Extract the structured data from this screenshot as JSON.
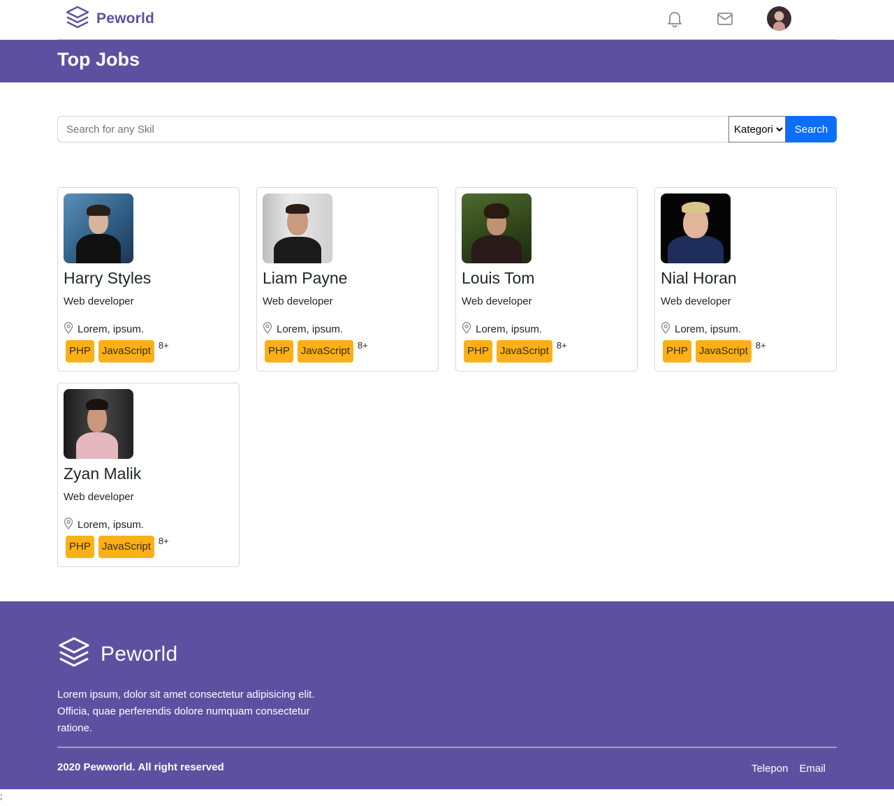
{
  "navbar": {
    "brand": "Peworld",
    "icons": [
      "layers-logo-icon",
      "bell-icon",
      "mail-icon"
    ]
  },
  "header": {
    "title": "Top Jobs"
  },
  "search": {
    "placeholder": "Search for any Skil",
    "value": "",
    "category": "Kategori",
    "button": "Search"
  },
  "cards": [
    {
      "name": "Harry Styles",
      "role": "Web developer",
      "location": "Lorem, ipsum.",
      "skills": [
        "PHP",
        "JavaScript"
      ],
      "more": "8+"
    },
    {
      "name": "Liam Payne",
      "role": "Web developer",
      "location": "Lorem, ipsum.",
      "skills": [
        "PHP",
        "JavaScript"
      ],
      "more": "8+"
    },
    {
      "name": "Louis Tom",
      "role": "Web developer",
      "location": "Lorem, ipsum.",
      "skills": [
        "PHP",
        "JavaScript"
      ],
      "more": "8+"
    },
    {
      "name": "Nial Horan",
      "role": "Web developer",
      "location": "Lorem, ipsum.",
      "skills": [
        "PHP",
        "JavaScript"
      ],
      "more": "8+"
    },
    {
      "name": "Zyan Malik",
      "role": "Web developer",
      "location": "Lorem, ipsum.",
      "skills": [
        "PHP",
        "JavaScript"
      ],
      "more": "8+"
    }
  ],
  "footer": {
    "brand": "Peworld",
    "description": "Lorem ipsum, dolor sit amet consectetur adipisicing elit. Officia, quae perferendis dolore numquam consectetur ratione.",
    "copyright": "2020 Pewworld. All right reserved",
    "links": [
      "Telepon",
      "Email"
    ]
  },
  "stray": ";",
  "colors": {
    "brand": "#5e50a1",
    "accent": "#fbb017",
    "primary": "#0d6efd"
  }
}
